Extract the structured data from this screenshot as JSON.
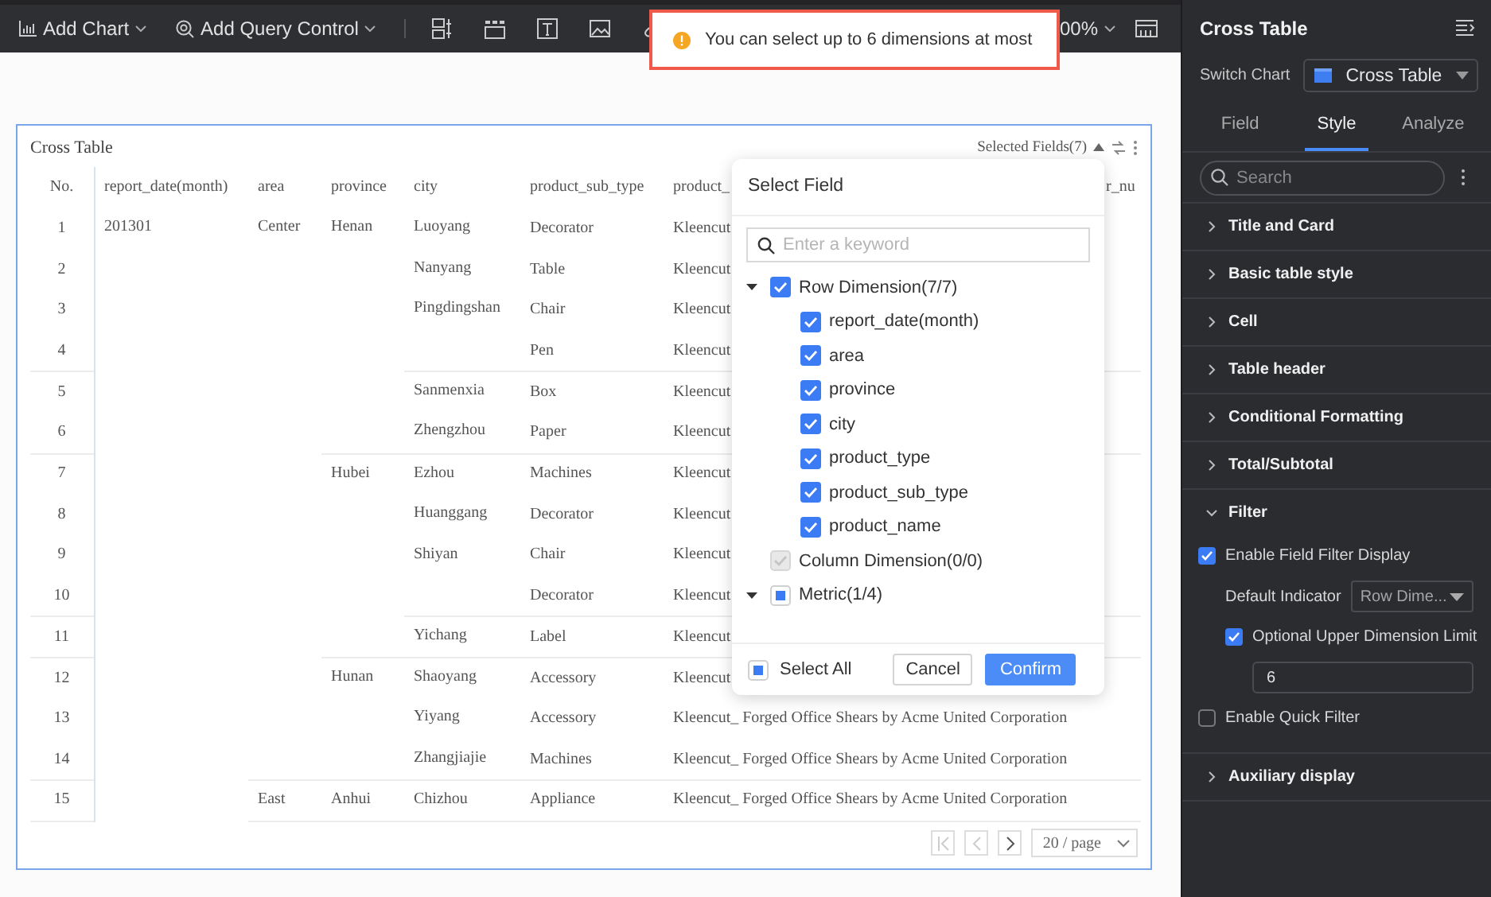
{
  "toolbar": {
    "menus": [
      "Add Chart",
      "Add Query Control"
    ],
    "zoom": "00%"
  },
  "toast": {
    "message": "You can select up to 6 dimensions at most"
  },
  "card": {
    "title": "Cross Table",
    "selected_fields": "Selected Fields(7)",
    "table": {
      "columns": [
        "No.",
        "report_date(month)",
        "area",
        "province",
        "city",
        "product_sub_type",
        "product_",
        "r_nu"
      ],
      "groups": [
        {
          "value": "201301",
          "children": [
            {
              "value": "Center",
              "children": [
                {
                  "value": "Henan",
                  "children": [
                    {
                      "value": "Luoyang",
                      "rows": [
                        {
                          "no": "1",
                          "cells": [
                            "Decorator",
                            "Kleencut"
                          ]
                        }
                      ]
                    },
                    {
                      "value": "Nanyang",
                      "rows": [
                        {
                          "no": "2",
                          "cells": [
                            "Table",
                            "Kleencut"
                          ]
                        }
                      ]
                    },
                    {
                      "value": "Pingdingshan",
                      "rows": [
                        {
                          "no": "3",
                          "cells": [
                            "Chair",
                            "Kleencut"
                          ]
                        },
                        {
                          "no": "4",
                          "cells": [
                            "Pen",
                            "Kleencut"
                          ]
                        }
                      ]
                    },
                    {
                      "value": "Sanmenxia",
                      "rows": [
                        {
                          "no": "5",
                          "cells": [
                            "Box",
                            "Kleencut"
                          ]
                        }
                      ]
                    },
                    {
                      "value": "Zhengzhou",
                      "rows": [
                        {
                          "no": "6",
                          "cells": [
                            "Paper",
                            "Kleencut"
                          ]
                        }
                      ]
                    }
                  ]
                },
                {
                  "value": "Hubei",
                  "children": [
                    {
                      "value": "Ezhou",
                      "rows": [
                        {
                          "no": "7",
                          "cells": [
                            "Machines",
                            "Kleencut"
                          ]
                        }
                      ]
                    },
                    {
                      "value": "Huanggang",
                      "rows": [
                        {
                          "no": "8",
                          "cells": [
                            "Decorator",
                            "Kleencut"
                          ]
                        }
                      ]
                    },
                    {
                      "value": "Shiyan",
                      "rows": [
                        {
                          "no": "9",
                          "cells": [
                            "Chair",
                            "Kleencut"
                          ]
                        },
                        {
                          "no": "10",
                          "cells": [
                            "Decorator",
                            "Kleencut"
                          ]
                        }
                      ]
                    },
                    {
                      "value": "Yichang",
                      "rows": [
                        {
                          "no": "11",
                          "cells": [
                            "Label",
                            "Kleencut"
                          ]
                        }
                      ]
                    }
                  ]
                },
                {
                  "value": "Hunan",
                  "children": [
                    {
                      "value": "Shaoyang",
                      "rows": [
                        {
                          "no": "12",
                          "cells": [
                            "Accessory",
                            "Kleencut"
                          ]
                        }
                      ]
                    },
                    {
                      "value": "Yiyang",
                      "rows": [
                        {
                          "no": "13",
                          "cells": [
                            "Accessory",
                            "Kleencut_ Forged Office Shears by Acme United Corporation"
                          ]
                        }
                      ]
                    },
                    {
                      "value": "Zhangjiajie",
                      "rows": [
                        {
                          "no": "14",
                          "cells": [
                            "Machines",
                            "Kleencut_ Forged Office Shears by Acme United Corporation"
                          ]
                        }
                      ]
                    }
                  ]
                }
              ]
            },
            {
              "value": "East",
              "children": [
                {
                  "value": "Anhui",
                  "children": [
                    {
                      "value": "Chizhou",
                      "rows": [
                        {
                          "no": "15",
                          "cells": [
                            "Appliance",
                            "Kleencut_ Forged Office Shears by Acme United Corporation"
                          ]
                        }
                      ]
                    }
                  ]
                }
              ]
            }
          ]
        }
      ]
    },
    "pagination": {
      "page_size": "20 / page"
    }
  },
  "field_popup": {
    "title": "Select Field",
    "search": {
      "placeholder": "Enter a keyword"
    },
    "tree": [
      {
        "label": "Row Dimension(7/7)",
        "checked": true,
        "partial": false,
        "disabled": false,
        "expanded": true,
        "children": [
          {
            "label": "report_date(month)",
            "checked": true
          },
          {
            "label": "area",
            "checked": true
          },
          {
            "label": "province",
            "checked": true
          },
          {
            "label": "city",
            "checked": true
          },
          {
            "label": "product_type",
            "checked": true
          },
          {
            "label": "product_sub_type",
            "checked": true
          },
          {
            "label": "product_name",
            "checked": true
          }
        ]
      },
      {
        "label": "Column Dimension(0/0)",
        "checked": true,
        "partial": false,
        "disabled": true
      },
      {
        "label": "Metric(1/4)",
        "checked": false,
        "partial": true,
        "disabled": false,
        "expanded": true
      }
    ],
    "select_all": {
      "label": "Select All",
      "checked": false,
      "partial": true
    },
    "buttons": [
      {
        "label": "Cancel",
        "primary": false
      },
      {
        "label": "Confirm",
        "primary": true
      }
    ]
  },
  "side_panel": {
    "title": "Cross Table",
    "switch_chart": {
      "label": "Switch Chart",
      "value": "Cross Table"
    },
    "tabs": [
      {
        "label": "Field",
        "selected": false
      },
      {
        "label": "Style",
        "selected": true
      },
      {
        "label": "Analyze",
        "selected": false
      }
    ],
    "search": {
      "placeholder": "Search"
    },
    "sections": [
      {
        "label": "Title and Card",
        "expanded": false
      },
      {
        "label": "Basic table style",
        "expanded": false
      },
      {
        "label": "Cell",
        "expanded": false
      },
      {
        "label": "Table header",
        "expanded": false
      },
      {
        "label": "Conditional Formatting",
        "expanded": false
      },
      {
        "label": "Total/Subtotal",
        "expanded": false
      },
      {
        "label": "Filter",
        "expanded": true,
        "options": [
          {
            "kind": "checkbox",
            "label": "Enable Field Filter Display",
            "checked": true,
            "children": [
              {
                "kind": "select",
                "label": "Default Indicator",
                "value": "Row Dime..."
              },
              {
                "kind": "checkbox",
                "label": "Optional Upper Dimension Limit",
                "checked": true,
                "children": [
                  {
                    "kind": "number",
                    "value": "6"
                  }
                ]
              }
            ]
          },
          {
            "kind": "checkbox",
            "label": "Enable Quick Filter",
            "checked": false
          }
        ]
      },
      {
        "label": "Auxiliary display",
        "expanded": false
      }
    ]
  }
}
